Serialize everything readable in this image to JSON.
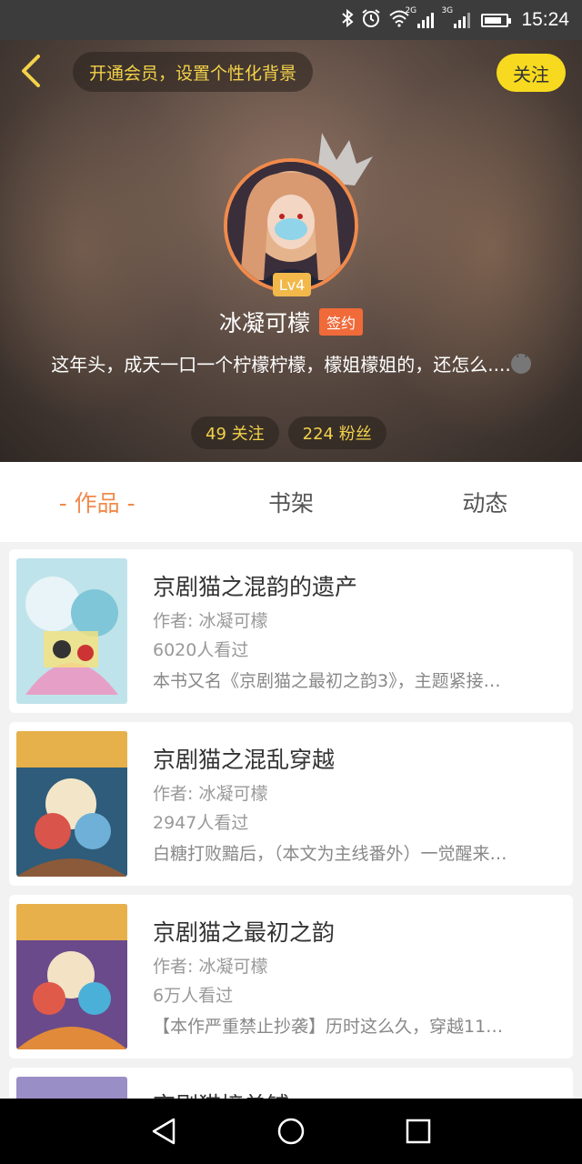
{
  "status_bar": {
    "time": "15:24",
    "network_1": "2G",
    "network_2": "3G",
    "icons": [
      "bluetooth-icon",
      "alarm-icon",
      "wifi-icon",
      "signal-icon",
      "signal-icon",
      "battery-icon"
    ]
  },
  "header": {
    "vip_prompt": "开通会员，设置个性化背景",
    "follow_label": "关注",
    "level": "Lv4",
    "user_name": "冰凝可檬",
    "sign_badge": "签约",
    "bio": "这年头，成天一口一个柠檬柠檬，檬姐檬姐的，还怎么....",
    "following": "49 关注",
    "followers": "224 粉丝"
  },
  "tabs": [
    {
      "label": "- 作品 -",
      "active": true
    },
    {
      "label": "书架",
      "active": false
    },
    {
      "label": "动态",
      "active": false
    }
  ],
  "works": [
    {
      "title": "京剧猫之混韵的遗产",
      "author": "作者: 冰凝可檬",
      "views": "6020人看过",
      "desc": "本书又名《京剧猫之最初之韵3》，主题紧接…"
    },
    {
      "title": "京剧猫之混乱穿越",
      "author": "作者: 冰凝可檬",
      "views": "2947人看过",
      "desc": "白糖打败黯后，（本文为主线番外）一觉醒来…"
    },
    {
      "title": "京剧猫之最初之韵",
      "author": "作者: 冰凝可檬",
      "views": "6万人看过",
      "desc": "【本作严重禁止抄袭】历时这么久，穿越11…"
    },
    {
      "title": "京剧猫接单铺"
    }
  ],
  "colors": {
    "accent": "#f08a4b",
    "follow_bg": "#f7da1f",
    "highlight_text": "#f3d24a"
  }
}
